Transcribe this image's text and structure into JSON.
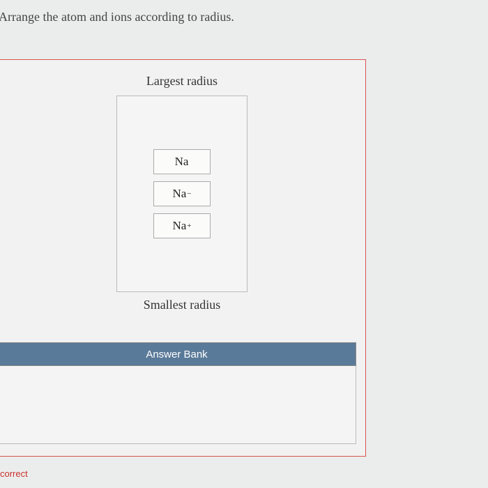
{
  "prompt": "Arrange the atom and ions according to radius.",
  "topLabel": "Largest radius",
  "bottomLabel": "Smallest radius",
  "tiles": {
    "t1": {
      "base": "Na",
      "sup": ""
    },
    "t2": {
      "base": "Na",
      "sup": "−"
    },
    "t3": {
      "base": "Na",
      "sup": "+"
    }
  },
  "answerBankLabel": "Answer Bank",
  "feedback": "correct"
}
